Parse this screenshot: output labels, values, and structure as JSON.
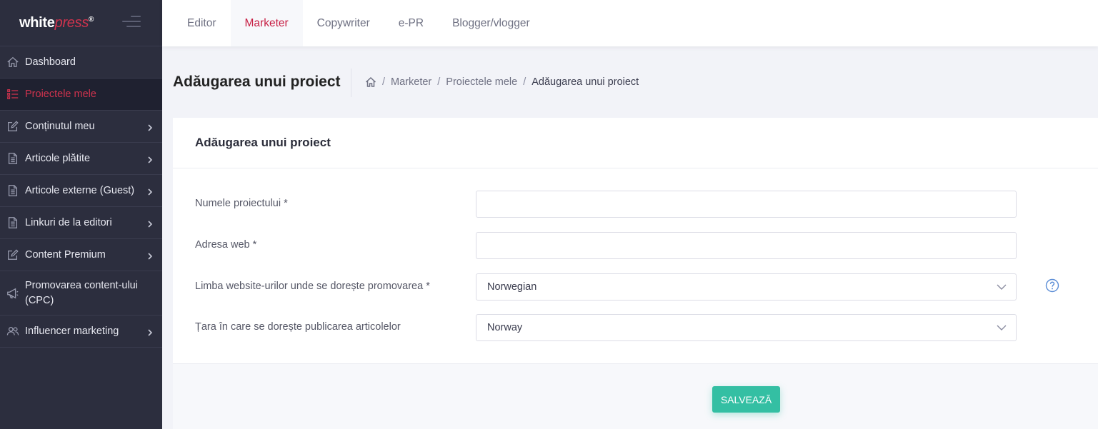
{
  "brand": {
    "logo_main": "white",
    "logo_accent": "press",
    "logo_mark": "®"
  },
  "colors": {
    "sidebar_bg": "#2c2e3e",
    "accent": "#d0334e",
    "save_button": "#34bfa3"
  },
  "sidebar": {
    "items": [
      {
        "label": "Dashboard",
        "icon": "home-icon",
        "has_chevron": false,
        "active": false
      },
      {
        "label": "Proiectele mele",
        "icon": "list-icon",
        "has_chevron": false,
        "active": true
      },
      {
        "label": "Conținutul meu",
        "icon": "edit-icon",
        "has_chevron": true,
        "active": false
      },
      {
        "label": "Articole plătite",
        "icon": "document-icon",
        "has_chevron": true,
        "active": false
      },
      {
        "label": "Articole externe (Guest)",
        "icon": "document-icon",
        "has_chevron": true,
        "active": false
      },
      {
        "label": "Linkuri de la editori",
        "icon": "document-icon",
        "has_chevron": true,
        "active": false
      },
      {
        "label": "Content Premium",
        "icon": "edit-icon",
        "has_chevron": true,
        "active": false
      },
      {
        "label": "Promovarea content-ului (CPC)",
        "icon": "megaphone-icon",
        "has_chevron": false,
        "active": false
      },
      {
        "label": "Influencer marketing",
        "icon": "users-icon",
        "has_chevron": true,
        "active": false
      }
    ]
  },
  "topnav": {
    "tabs": [
      {
        "label": "Editor",
        "active": false
      },
      {
        "label": "Marketer",
        "active": true
      },
      {
        "label": "Copywriter",
        "active": false
      },
      {
        "label": "e-PR",
        "active": false
      },
      {
        "label": "Blogger/vlogger",
        "active": false
      }
    ]
  },
  "subheader": {
    "title": "Adăugarea unui proiect",
    "breadcrumb": [
      "Marketer",
      "Proiectele mele",
      "Adăugarea unui proiect"
    ],
    "separator": "/"
  },
  "form": {
    "title": "Adăugarea unui proiect",
    "project_name": {
      "label": "Numele proiectului *",
      "value": ""
    },
    "website": {
      "label": "Adresa web *",
      "value": ""
    },
    "language": {
      "label": "Limba website-urilor unde se dorește promovarea *",
      "selected": "Norwegian"
    },
    "country": {
      "label": "Țara în care se dorește publicarea articolelor",
      "selected": "Norway"
    },
    "save_label": "SALVEAZĂ"
  }
}
